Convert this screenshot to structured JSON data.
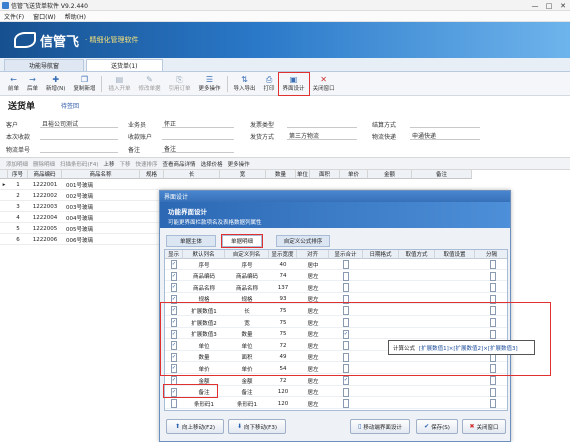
{
  "app": {
    "title": "信管飞送货单软件 V9.2.440",
    "window_controls": [
      "—",
      "□",
      "✕"
    ]
  },
  "menu": [
    "文件(F)",
    "窗口(W)",
    "帮助(H)"
  ],
  "banner": {
    "brand": "信管飞",
    "slogan": "· 精细化管理软件"
  },
  "tabs": [
    {
      "label": "功能导航窗"
    },
    {
      "label": "送货单(1)"
    }
  ],
  "toolbar": [
    {
      "label": "前单",
      "icon": "←"
    },
    {
      "label": "后单",
      "icon": "→"
    },
    {
      "label": "新增(N)",
      "icon": "✚"
    },
    {
      "label": "复制新增",
      "icon": "❐"
    },
    {
      "label": "插入开单",
      "icon": "▤"
    },
    {
      "label": "修改单据",
      "icon": "✎"
    },
    {
      "label": "引用订单",
      "icon": "⎘"
    },
    {
      "label": "更多操作",
      "icon": "☰"
    },
    {
      "label": "导入导出",
      "icon": "⇅"
    },
    {
      "label": "打印",
      "icon": "⎙"
    },
    {
      "label": "界面设计",
      "icon": "▣"
    },
    {
      "label": "关闭窗口",
      "icon": "✕"
    }
  ],
  "page": {
    "title": "送货单",
    "number": "待签回"
  },
  "form": {
    "customer_label": "客户",
    "customer_value": "且裕公司测试",
    "salesman_label": "业务员",
    "salesman_value": "怀正",
    "shipping_type_label": "发票类型",
    "settle_label": "结算方式",
    "receipt_label": "本次收款",
    "collect_label": "收款账户",
    "ship_method_label": "发货方式",
    "ship_method_value": "第三方物流",
    "logistics_label": "物流快递",
    "logistics_value": "申通快递",
    "tracking_label": "物流单号",
    "remark_label": "备注",
    "remark_value": "备注"
  },
  "gridbar": [
    "添加明细",
    "删除明细",
    "扫描条形码(F4)",
    "上移",
    "下移",
    "快速排序",
    "查看商品详情",
    "选择价格",
    "更多操作"
  ],
  "grid": {
    "headers": [
      "序号",
      "商品编码",
      "商品名称",
      "规格",
      "长",
      "宽",
      "数量",
      "单位",
      "面积",
      "单价",
      "金额",
      "备注"
    ],
    "rows": [
      [
        "1",
        "1222001",
        "001号玻璃"
      ],
      [
        "2",
        "1222002",
        "002号玻璃"
      ],
      [
        "3",
        "1222003",
        "003号玻璃"
      ],
      [
        "4",
        "1222004",
        "004号玻璃"
      ],
      [
        "5",
        "1222005",
        "005号玻璃"
      ],
      [
        "6",
        "1222006",
        "006号玻璃"
      ]
    ]
  },
  "dialog": {
    "title": "界面设计",
    "heading": "功能界面设计",
    "subheading": "可能更界面栏款项名及表格数据列属性",
    "tabs": [
      "单据主体",
      "单据明细",
      "自定义公式排序"
    ],
    "headers": [
      "显示",
      "默认列名",
      "自定义列名",
      "显示宽度",
      "对齐",
      "显示合计",
      "日期格式",
      "取值方式",
      "取值设置",
      "分隔"
    ],
    "rows": [
      {
        "show": true,
        "name": "序号",
        "custom": "序号",
        "width": "40",
        "align": "居中",
        "sum": false
      },
      {
        "show": true,
        "name": "商品编码",
        "custom": "商品编码",
        "width": "74",
        "align": "居左",
        "sum": false
      },
      {
        "show": true,
        "name": "商品名称",
        "custom": "商品名称",
        "width": "137",
        "align": "居左",
        "sum": false
      },
      {
        "show": true,
        "name": "规格",
        "custom": "规格",
        "width": "93",
        "align": "居左",
        "sum": false
      },
      {
        "show": true,
        "name": "扩展数值1",
        "custom": "长",
        "width": "75",
        "align": "居左",
        "sum": false
      },
      {
        "show": true,
        "name": "扩展数值2",
        "custom": "宽",
        "width": "75",
        "align": "居左",
        "sum": false
      },
      {
        "show": true,
        "name": "扩展数值3",
        "custom": "数量",
        "width": "75",
        "align": "居左",
        "sum": true
      },
      {
        "show": true,
        "name": "单位",
        "custom": "单位",
        "width": "72",
        "align": "居左",
        "sum": false
      },
      {
        "show": true,
        "name": "数量",
        "custom": "面积",
        "width": "49",
        "align": "居左",
        "sum": false
      },
      {
        "show": true,
        "name": "单价",
        "custom": "单价",
        "width": "54",
        "align": "居左",
        "sum": false
      },
      {
        "show": true,
        "name": "金额",
        "custom": "金额",
        "width": "72",
        "align": "居左",
        "sum": true
      },
      {
        "show": true,
        "name": "备注",
        "custom": "备注",
        "width": "120",
        "align": "居左",
        "sum": false
      },
      {
        "show": false,
        "name": "条形码1",
        "custom": "条形码1",
        "width": "120",
        "align": "居左",
        "sum": false
      }
    ],
    "buttons": [
      "向上移动(F2)",
      "向下移动(F3)",
      "移动端界面设计",
      "保存(S)",
      "关闭窗口"
    ]
  },
  "formula": {
    "label": "计算公式",
    "value": "[扩展数值1]×[扩展数值2]×[扩展数值3]"
  },
  "colors": {
    "accent": "#2a78c8",
    "highlight": "#e03030",
    "dialog_header": "#3570b8"
  }
}
